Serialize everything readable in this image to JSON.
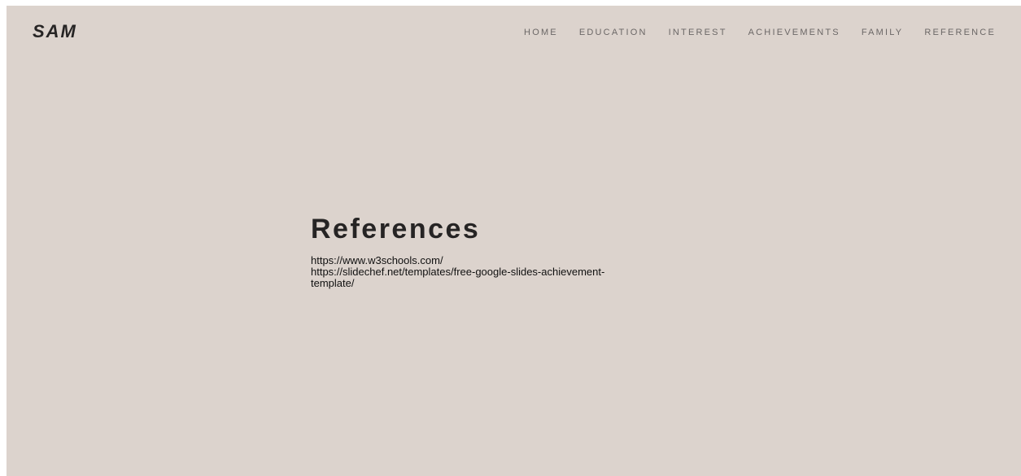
{
  "header": {
    "brand": "SAM",
    "nav": [
      {
        "label": "HOME"
      },
      {
        "label": "EDUCATION"
      },
      {
        "label": "INTEREST"
      },
      {
        "label": "ACHIEVEMENTS"
      },
      {
        "label": "FAMILY"
      },
      {
        "label": "REFERENCE"
      }
    ]
  },
  "main": {
    "title": "References",
    "links": [
      "https://www.w3schools.com/",
      "https://slidechef.net/templates/free-google-slides-achievement-template/"
    ]
  },
  "colors": {
    "background": "#dcd3cd",
    "text_dark": "#262424",
    "nav_text": "#6b6766"
  }
}
